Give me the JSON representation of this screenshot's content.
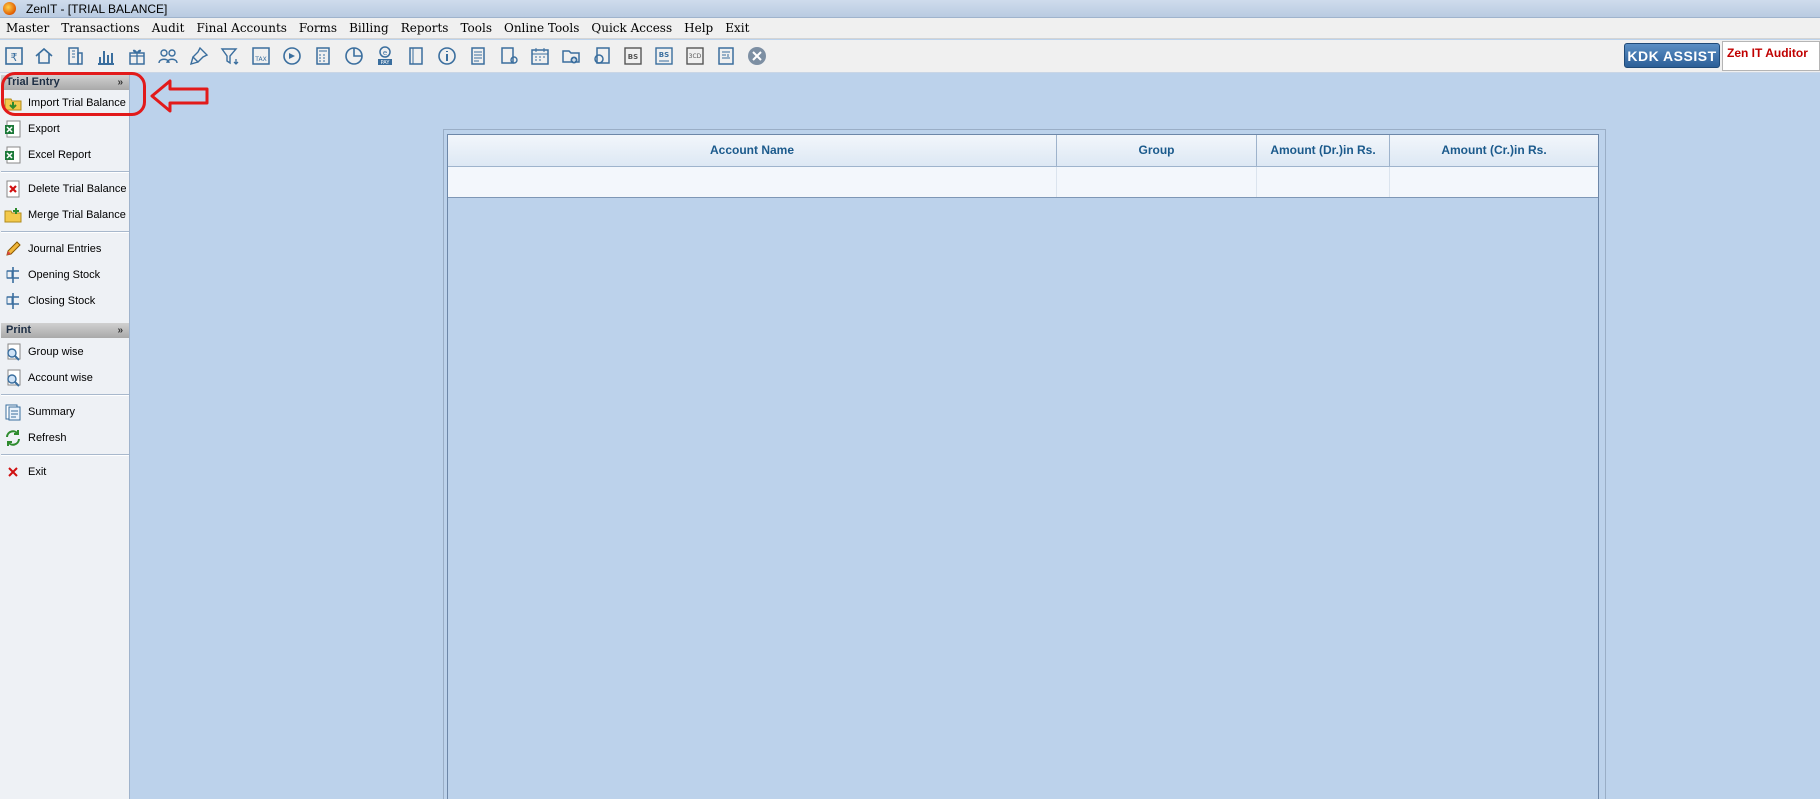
{
  "window": {
    "title": "ZenIT - [TRIAL BALANCE]"
  },
  "menubar": {
    "items": [
      "Master",
      "Transactions",
      "Audit",
      "Final Accounts",
      "Forms",
      "Billing",
      "Reports",
      "Tools",
      "Online Tools",
      "Quick Access",
      "Help",
      "Exit"
    ]
  },
  "toolbar": {
    "icons": [
      "rupee-ledger-icon",
      "home-icon",
      "building-icon",
      "bar-chart-icon",
      "gift-icon",
      "users-icon",
      "pin-icon",
      "filter-icon",
      "tax-icon",
      "pie-refresh-icon",
      "calculator-icon",
      "pie-chart-icon",
      "e-pay-icon",
      "book-icon",
      "info-icon",
      "document-icon",
      "user-document-icon",
      "calendar-icon",
      "folder-add-icon",
      "search-document-icon",
      "bs-icon",
      "bs-report-icon",
      "3cd-icon",
      "form-icon",
      "close-circle-icon"
    ],
    "kdk_assist": "KDK ASSIST",
    "auditor_label": "Zen IT Auditor"
  },
  "sidebar": {
    "sections": [
      {
        "title": "Trial Entry",
        "collapse_glyph": "»",
        "items": [
          {
            "label": "Import Trial Balance",
            "icon": "import-folder-icon"
          },
          {
            "label": "Export",
            "icon": "excel-export-icon"
          },
          {
            "label": "Excel Report",
            "icon": "excel-report-icon"
          },
          {
            "label": "Delete Trial Balance",
            "icon": "delete-document-icon"
          },
          {
            "label": "Merge Trial Balance",
            "icon": "merge-folder-icon"
          },
          {
            "label": "Journal Entries",
            "icon": "pencil-icon"
          },
          {
            "label": "Opening Stock",
            "icon": "stock-icon"
          },
          {
            "label": "Closing Stock",
            "icon": "stock-icon"
          }
        ]
      },
      {
        "title": "Print",
        "collapse_glyph": "»",
        "items": [
          {
            "label": "Group wise",
            "icon": "magnify-document-icon"
          },
          {
            "label": "Account wise",
            "icon": "magnify-document-icon"
          },
          {
            "label": "Summary",
            "icon": "summary-icon"
          },
          {
            "label": "Refresh",
            "icon": "refresh-icon"
          },
          {
            "label": "Exit",
            "icon": "close-x-icon"
          }
        ]
      }
    ]
  },
  "grid": {
    "columns": [
      "Account Name",
      "Group",
      "Amount (Dr.)in Rs.",
      "Amount (Cr.)in Rs."
    ],
    "rows": []
  },
  "colors": {
    "background": "#bcd2eb",
    "header_text": "#1b5a8c",
    "highlight": "#e21a1a",
    "kdk_button": "#2c5f97",
    "auditor_text": "#c00000"
  }
}
